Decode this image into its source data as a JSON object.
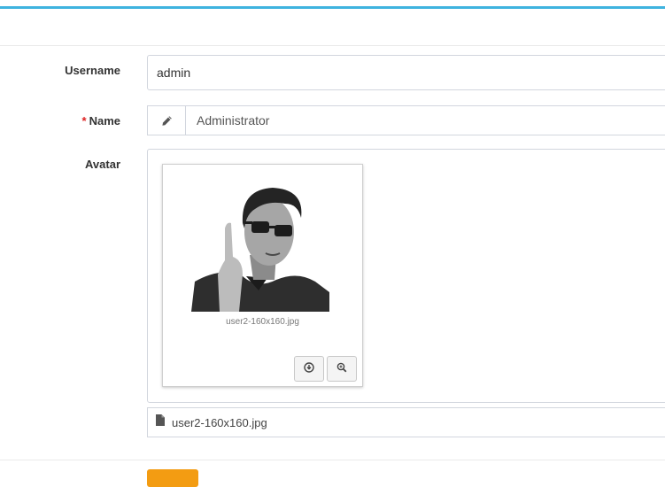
{
  "colors": {
    "accent": "#3fb3df",
    "required": "#dd1f1f",
    "submit": "#f39c12"
  },
  "form": {
    "username": {
      "label": "Username",
      "value": "admin"
    },
    "name": {
      "required_marker": "*",
      "label": "Name",
      "value": "Administrator",
      "icon": "pencil-icon"
    },
    "avatar": {
      "label": "Avatar",
      "preview_caption": "user2-160x160.jpg",
      "actions": [
        {
          "name": "download",
          "icon": "download-icon"
        },
        {
          "name": "zoom",
          "icon": "zoom-in-icon"
        }
      ],
      "file_icon": "file-icon",
      "file_name": "user2-160x160.jpg"
    }
  }
}
